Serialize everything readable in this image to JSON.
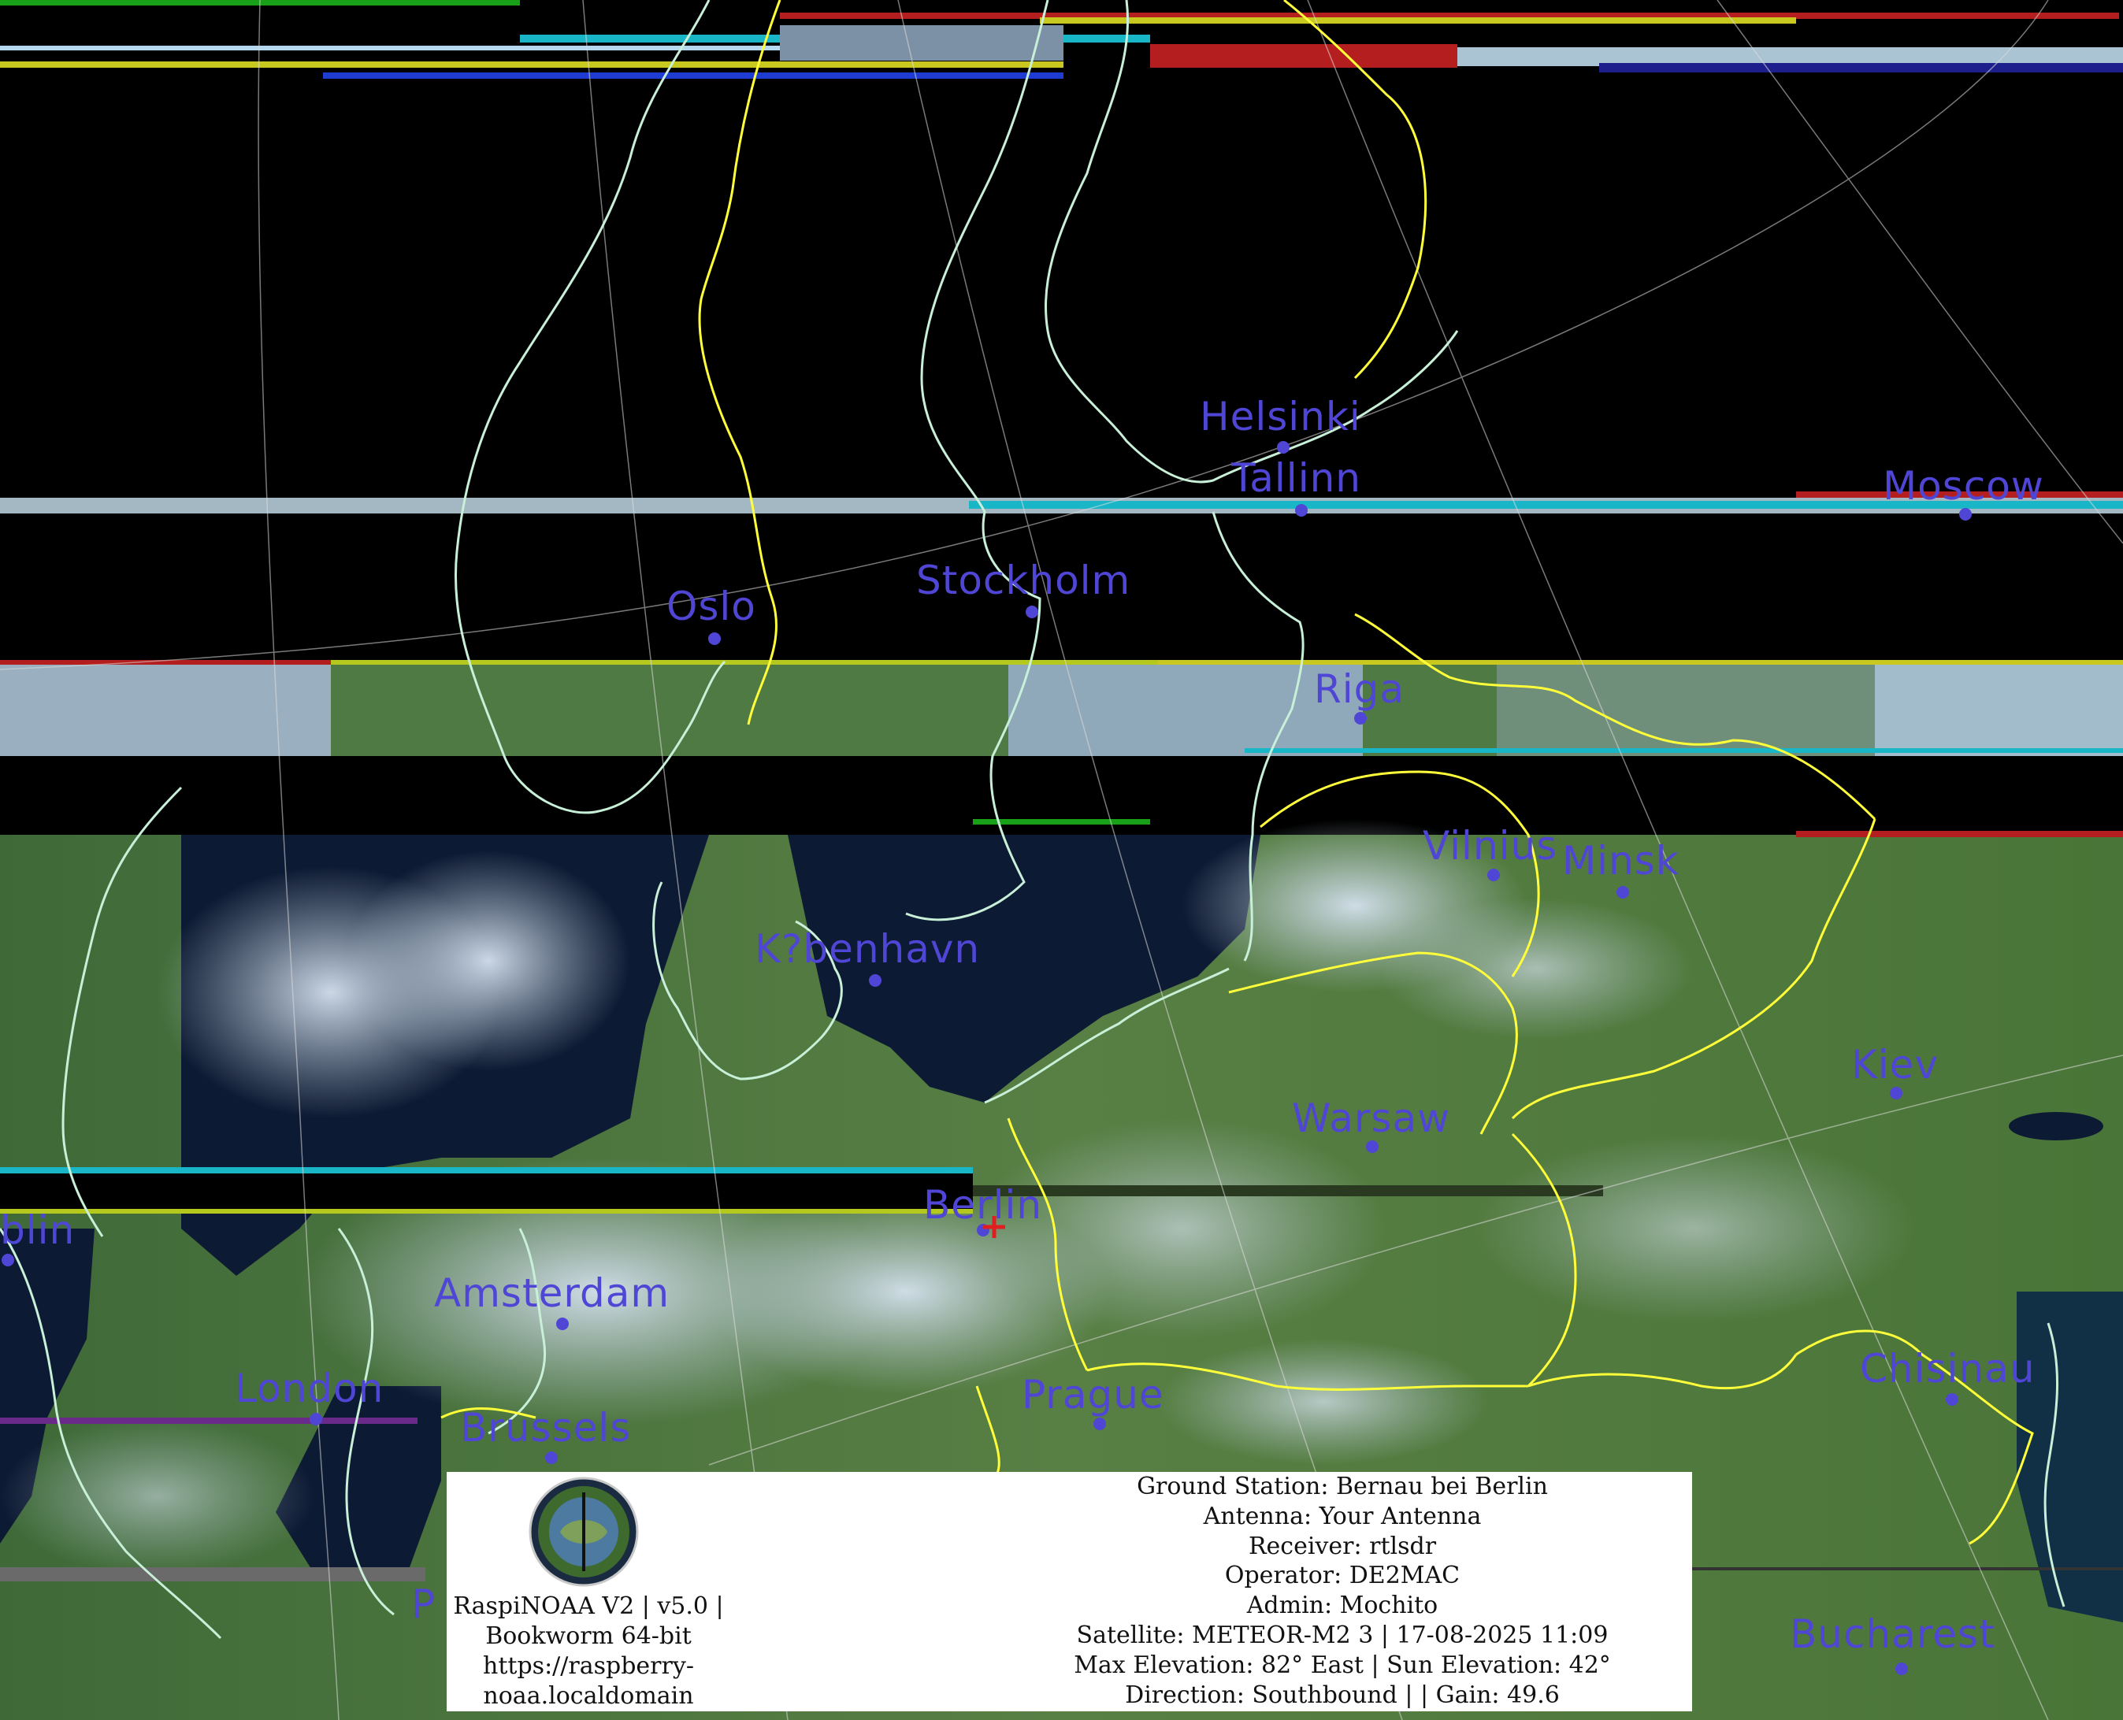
{
  "cities": [
    {
      "name": "Helsinki",
      "lbl": [
        1523,
        504
      ],
      "dot": [
        1629,
        568
      ]
    },
    {
      "name": "Tallinn",
      "lbl": [
        1563,
        582
      ],
      "dot": [
        1652,
        648
      ]
    },
    {
      "name": "Moscow",
      "lbl": [
        2390,
        592
      ],
      "dot": [
        2495,
        653
      ]
    },
    {
      "name": "Oslo",
      "lbl": [
        846,
        745
      ],
      "dot": [
        907,
        811
      ]
    },
    {
      "name": "Stockholm",
      "lbl": [
        1163,
        712
      ],
      "dot": [
        1310,
        777
      ]
    },
    {
      "name": "Riga",
      "lbl": [
        1668,
        850
      ],
      "dot": [
        1727,
        912
      ]
    },
    {
      "name": "Vilnius",
      "lbl": [
        1806,
        1049
      ],
      "dot": [
        1896,
        1111
      ]
    },
    {
      "name": "Minsk",
      "lbl": [
        1983,
        1068
      ],
      "dot": [
        2060,
        1133
      ]
    },
    {
      "name": "K?benhavn",
      "lbl": [
        958,
        1180
      ],
      "dot": [
        1111,
        1245
      ]
    },
    {
      "name": "Kiev",
      "lbl": [
        2350,
        1327
      ],
      "dot": [
        2407,
        1388
      ]
    },
    {
      "name": "Warsaw",
      "lbl": [
        1640,
        1395
      ],
      "dot": [
        1742,
        1456
      ]
    },
    {
      "name": "Berlin",
      "lbl": [
        1172,
        1505
      ],
      "dot": [
        1248,
        1562
      ]
    },
    {
      "name": "blin",
      "lbl": [
        0,
        1537
      ],
      "dot": [
        10,
        1600
      ]
    },
    {
      "name": "Amsterdam",
      "lbl": [
        551,
        1617
      ],
      "dot": [
        714,
        1681
      ]
    },
    {
      "name": "London",
      "lbl": [
        298,
        1738
      ],
      "dot": [
        401,
        1802
      ]
    },
    {
      "name": "Prague",
      "lbl": [
        1297,
        1746
      ],
      "dot": [
        1396,
        1808
      ]
    },
    {
      "name": "Chisinau",
      "lbl": [
        2361,
        1713
      ],
      "dot": [
        2478,
        1777
      ]
    },
    {
      "name": "Brussels",
      "lbl": [
        584,
        1788
      ],
      "dot": [
        700,
        1851
      ]
    },
    {
      "name": "P",
      "lbl": [
        522,
        2012
      ],
      "dot": null
    },
    {
      "name": "Bucharest",
      "lbl": [
        2272,
        2050
      ],
      "dot": [
        2414,
        2119
      ]
    }
  ],
  "footer_left": {
    "line1": "RaspiNOAA V2 | v5.0 |",
    "line2": "Bookworm 64-bit",
    "line3": "https://raspberry-",
    "line4": "noaa.localdomain"
  },
  "station_info": {
    "ground_station": "Ground Station: Bernau bei Berlin",
    "antenna": "Antenna: Your Antenna",
    "receiver": "Receiver: rtlsdr",
    "operator": "Operator: DE2MAC",
    "admin": "Admin: Mochito",
    "satellite": "Satellite: METEOR-M2 3 | 17-08-2025 11:09",
    "elevation": "Max Elevation: 82° East | Sun Elevation: 42°",
    "direction": "Direction: Southbound | | Gain: 49.6"
  },
  "colors": {
    "city_label": "#5046d6",
    "coastline": "#c8f0d8",
    "border": "#ffff3a",
    "land": "#4e7a3c",
    "sea": "#0d1a33",
    "cloud": "#c4d2e0"
  },
  "icons": {
    "station_marker": "red-cross-icon",
    "logo": "raspinoaa-emblem-icon"
  }
}
